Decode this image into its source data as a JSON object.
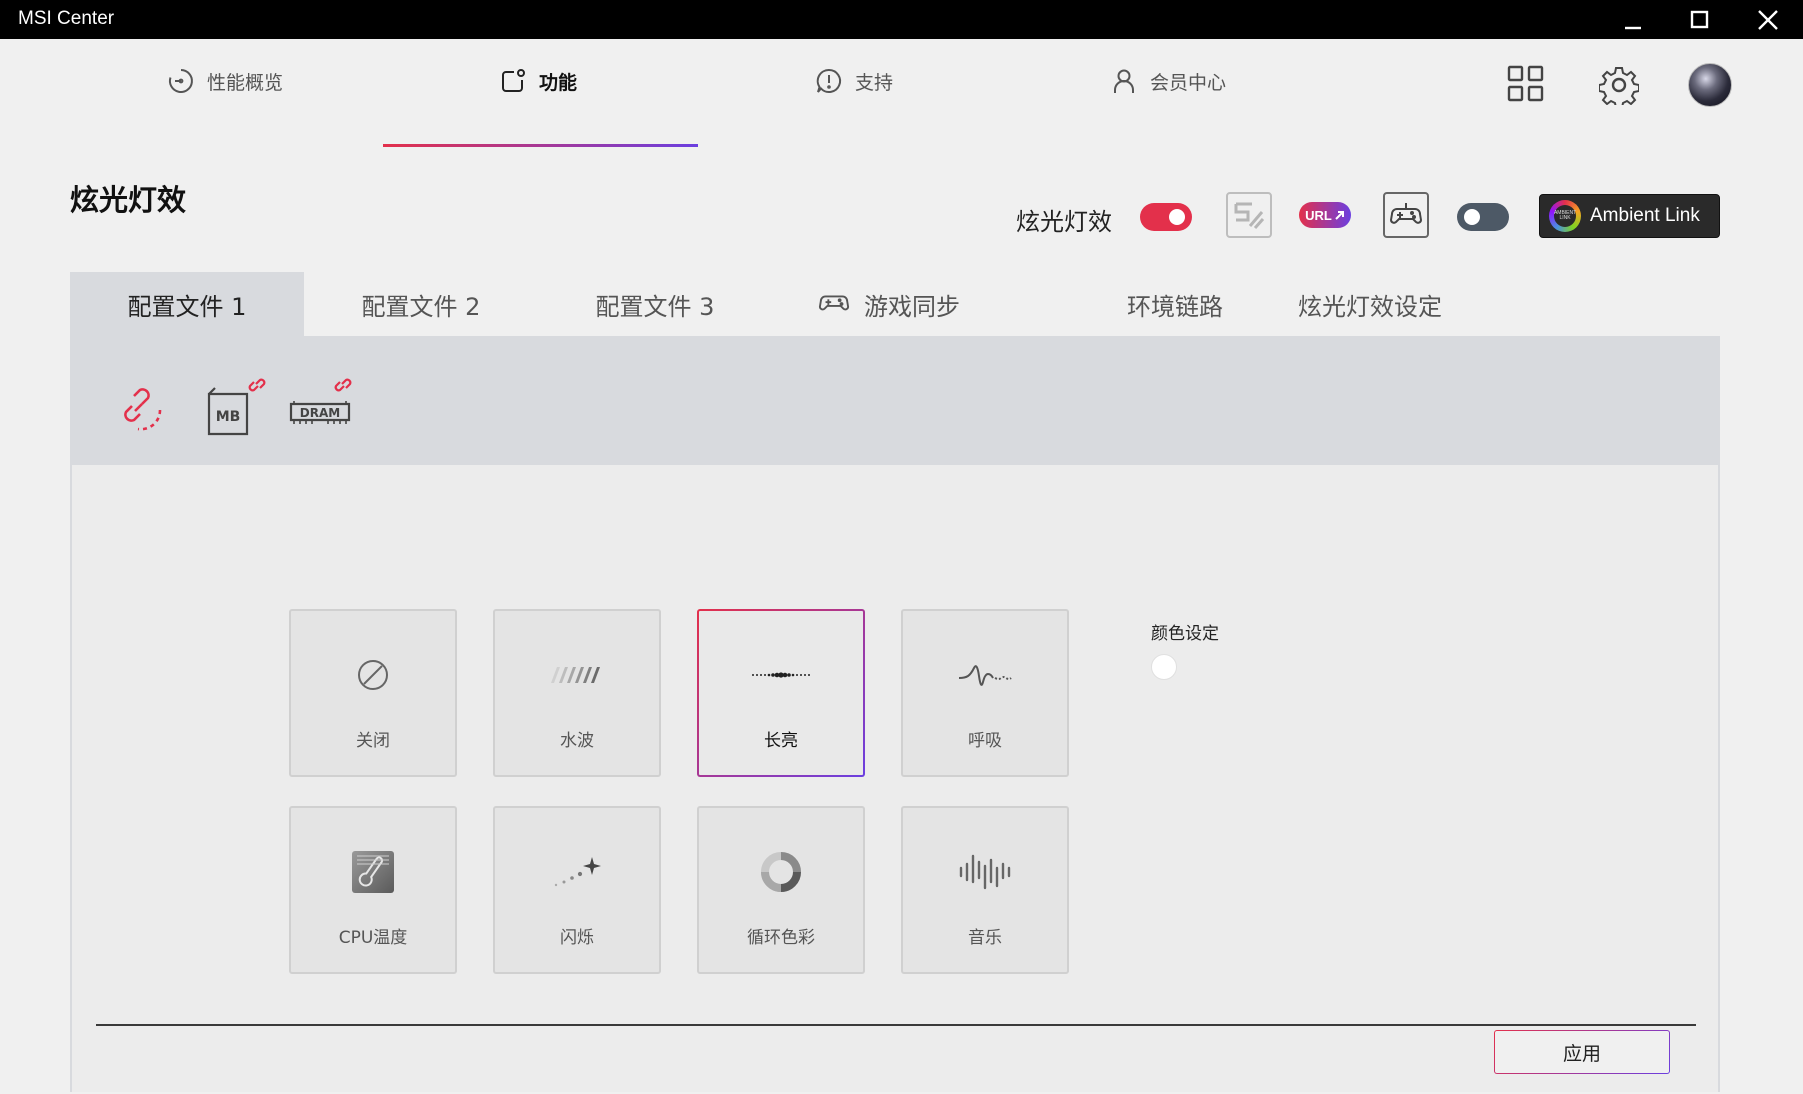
{
  "window": {
    "title": "MSI Center",
    "controls": {
      "minimize": "minimize-icon",
      "maximize": "maximize-icon",
      "close": "close-icon"
    }
  },
  "topnav": {
    "items": [
      {
        "label": "性能概览",
        "icon": "gauge-icon"
      },
      {
        "label": "功能",
        "icon": "feature-icon",
        "active": true
      },
      {
        "label": "支持",
        "icon": "support-icon"
      },
      {
        "label": "会员中心",
        "icon": "user-icon"
      }
    ],
    "right_icons": [
      "grid-icon",
      "gear-icon",
      "avatar"
    ]
  },
  "page": {
    "title": "炫光灯效"
  },
  "rgb_controls": {
    "label": "炫光灯效",
    "main_toggle_on": true,
    "url_badge": "URL",
    "second_toggle_on": false,
    "ambient_link_label": "Ambient Link",
    "ambient_logo_text": "AMBIENT LINK"
  },
  "tabs": [
    {
      "label": "配置文件 1",
      "active": true
    },
    {
      "label": "配置文件 2"
    },
    {
      "label": "配置文件 3"
    },
    {
      "label": "游戏同步",
      "icon": "gamepad-icon"
    },
    {
      "label": "环境链路"
    },
    {
      "label": "炫光灯效设定"
    }
  ],
  "devices": [
    {
      "name": "sync-link-icon"
    },
    {
      "name": "MB",
      "label": "MB",
      "linked": true
    },
    {
      "name": "DRAM",
      "label": "DRAM",
      "linked": true
    }
  ],
  "effects": [
    {
      "label": "关闭",
      "icon": "off-icon"
    },
    {
      "label": "水波",
      "icon": "wave-icon"
    },
    {
      "label": "长亮",
      "icon": "steady-icon",
      "selected": true
    },
    {
      "label": "呼吸",
      "icon": "breathing-icon"
    },
    {
      "label": "CPU温度",
      "icon": "cpu-temp-icon"
    },
    {
      "label": "闪烁",
      "icon": "flash-icon"
    },
    {
      "label": "循环色彩",
      "icon": "color-cycle-icon"
    },
    {
      "label": "音乐",
      "icon": "music-icon"
    }
  ],
  "color_settings": {
    "label": "颜色设定",
    "color": "#ffffff"
  },
  "apply_label": "应用",
  "colors": {
    "accent_red": "#e3304b",
    "accent_purple": "#6b3fe0",
    "titlebar": "#000000",
    "background": "#f0f0f0"
  }
}
